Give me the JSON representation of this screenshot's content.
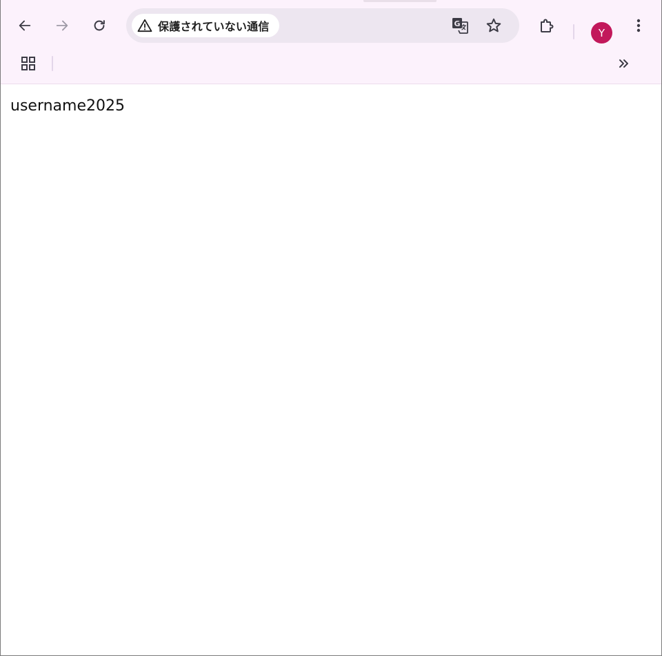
{
  "toolbar": {
    "back_icon": "arrow-left-icon",
    "forward_icon": "arrow-right-icon",
    "reload_icon": "reload-icon",
    "security_icon": "warning-triangle-icon",
    "security_label": "保護されていない通信",
    "translate_icon": "translate-icon",
    "bookmark_icon": "star-icon",
    "extensions_icon": "puzzle-icon",
    "profile_initial": "Y",
    "profile_color": "#c2185b",
    "menu_icon": "kebab-menu-icon"
  },
  "bookmarks_bar": {
    "apps_icon": "apps-grid-icon",
    "overflow_label": "»"
  },
  "page": {
    "text": "username2025"
  },
  "colors": {
    "chrome_bg": "#fcf2fc",
    "omnibox_bg": "#ede6f0",
    "icon": "#3c3b45",
    "icon_disabled": "#9e9aa6"
  }
}
